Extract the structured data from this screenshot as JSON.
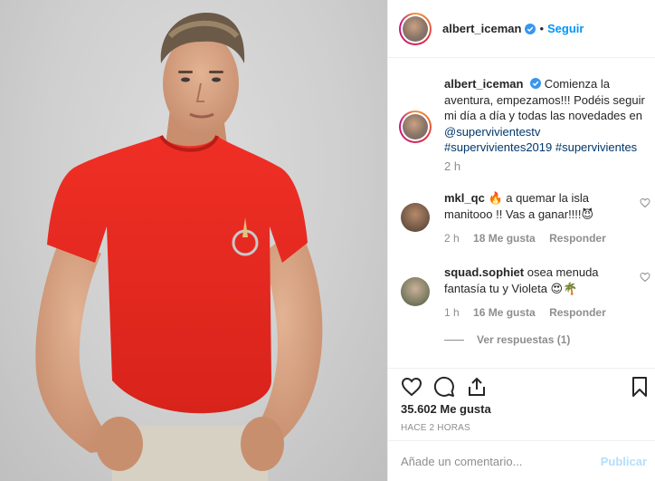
{
  "post": {
    "username": "albert_iceman",
    "separator": "•",
    "follow_label": "Seguir",
    "caption": {
      "username": "albert_iceman",
      "text": "Comienza la aventura, empezamos!!! Podéis seguir mi día a día y todas las novedades en",
      "mention": "@supervivientestv",
      "hashtags": "#supervivientes2019 #supervivientes",
      "time": "2 h"
    },
    "comments": [
      {
        "username": "mkl_qc",
        "text": "🔥 a quemar la isla manitooo !! Vas a ganar!!!!😈",
        "time": "2 h",
        "likes": "18 Me gusta",
        "reply_label": "Responder"
      },
      {
        "username": "squad.sophiet",
        "text": "osea menuda fantasía tu y Violeta 😍🌴",
        "time": "1 h",
        "likes": "16 Me gusta",
        "reply_label": "Responder"
      }
    ],
    "view_replies": "Ver respuestas (1)",
    "like_count": "35.602 Me gusta",
    "posted_ago": "HACE 2 HORAS",
    "comment_placeholder": "Añade un comentario...",
    "publish_label": "Publicar"
  },
  "colors": {
    "accent": "#0095f6",
    "shirt": "#e8281f",
    "publish_disabled": "#b2dffc",
    "muted": "#8e8e8e"
  },
  "icons": {
    "verified": "verified-badge-icon",
    "like": "heart-icon",
    "comment": "speech-bubble-icon",
    "share": "share-icon",
    "save": "bookmark-icon"
  }
}
